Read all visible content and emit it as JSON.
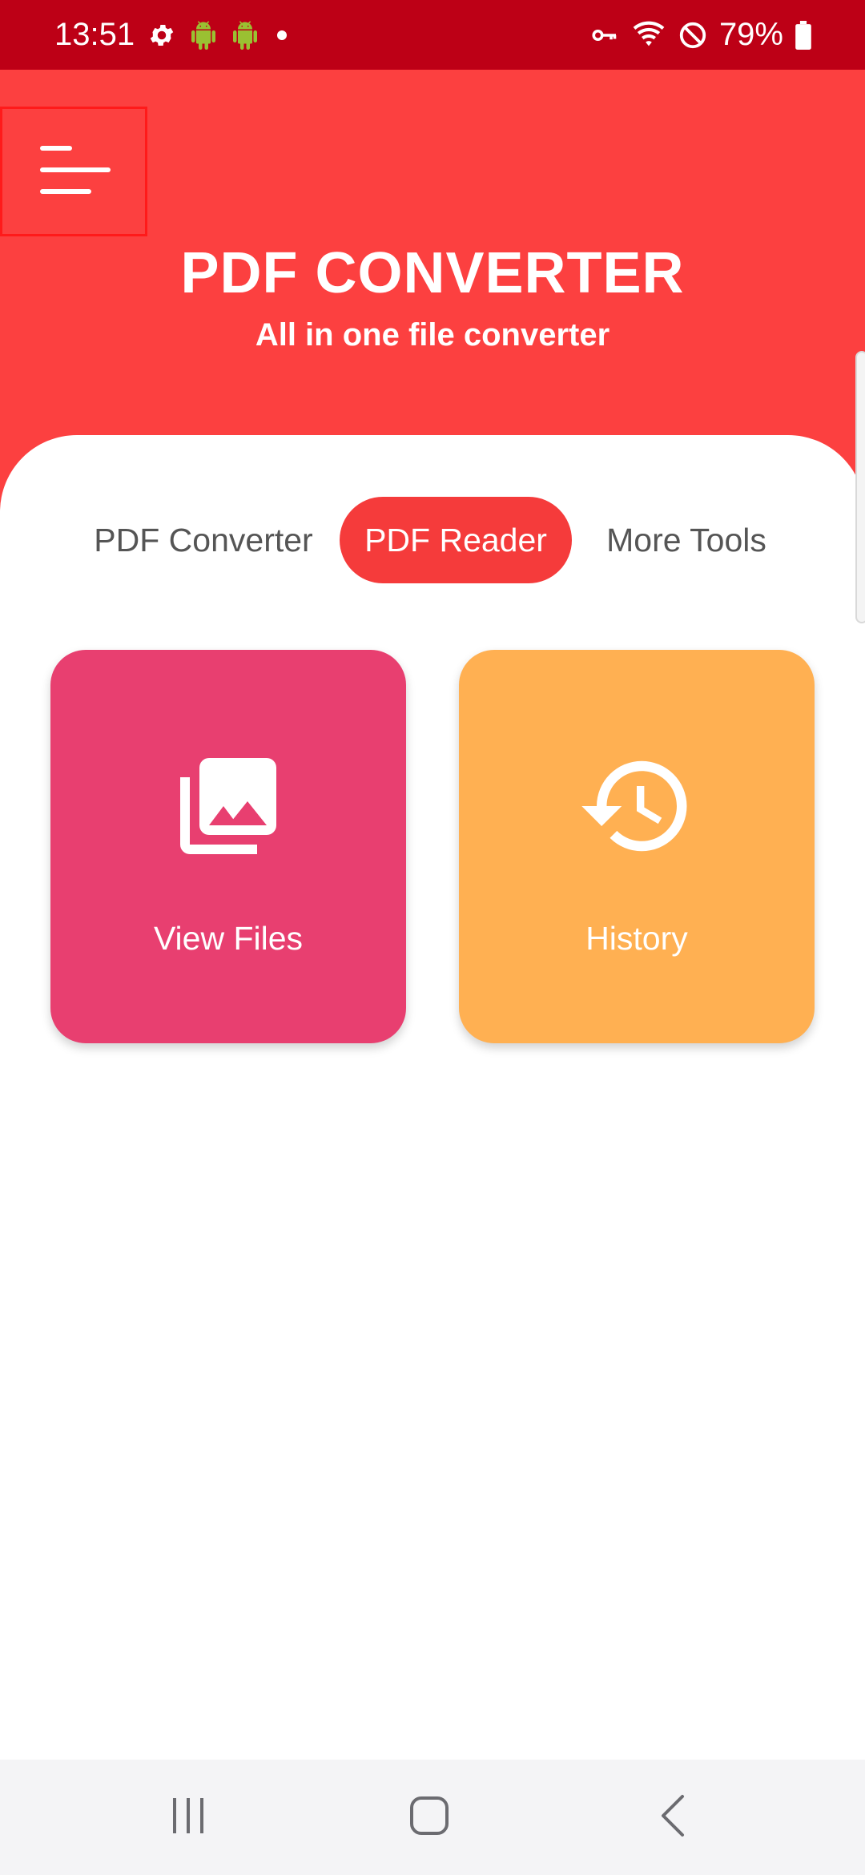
{
  "status_bar": {
    "time": "13:51",
    "battery": "79%",
    "left_icons": [
      "gear-icon",
      "android-icon",
      "android-icon",
      "dot-icon"
    ],
    "right_icons": [
      "key-icon",
      "wifi-icon",
      "block-icon",
      "battery-icon"
    ]
  },
  "header": {
    "menu_icon": "menu-icon",
    "title": "PDF CONVERTER",
    "subtitle": "All in one file converter"
  },
  "tabs": [
    {
      "label": "PDF Converter",
      "active": false
    },
    {
      "label": "PDF Reader",
      "active": true
    },
    {
      "label": "More Tools",
      "active": false
    }
  ],
  "tiles": [
    {
      "label": "View Files",
      "icon": "image-gallery-icon",
      "color": "#e83f70"
    },
    {
      "label": "History",
      "icon": "history-icon",
      "color": "#ffb052"
    }
  ],
  "nav_bar": {
    "icons": [
      "recents-icon",
      "home-icon",
      "back-icon"
    ]
  },
  "colors": {
    "status_bar": "#bd0016",
    "header": "#fc4040",
    "accent": "#f53b3b"
  }
}
